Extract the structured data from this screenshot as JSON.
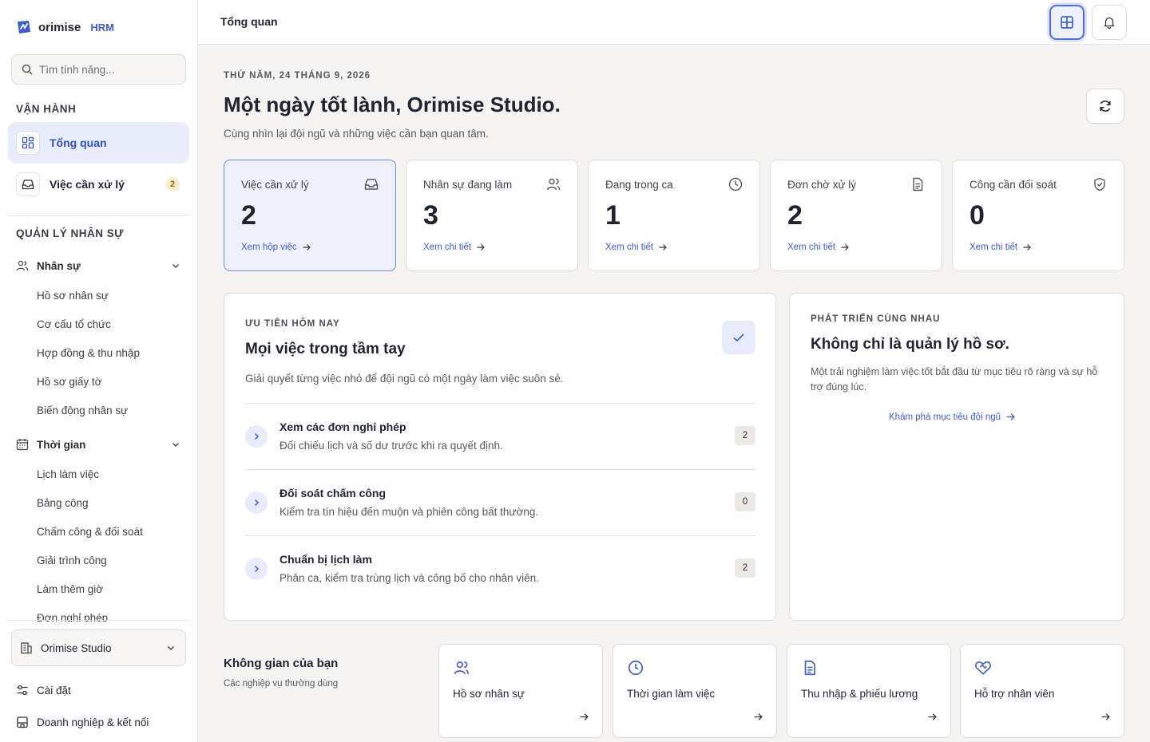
{
  "brand": {
    "name": "orimise",
    "suffix": "HRM",
    "accent": "#3b5bdb"
  },
  "search": {
    "placeholder": "Tìm tính năng..."
  },
  "sidebar": {
    "section_ops": "VẬN HÀNH",
    "nav": [
      {
        "label": "Tổng quan",
        "icon": "dashboard-icon",
        "active": true
      },
      {
        "label": "Việc cần xử lý",
        "icon": "inbox-icon",
        "badge": "2"
      }
    ],
    "section_hr": "QUẢN LÝ NHÂN SỰ",
    "groups": [
      {
        "label": "Nhân sự",
        "icon": "users-icon",
        "items": [
          "Hồ sơ nhân sự",
          "Cơ cấu tổ chức",
          "Hợp đồng & thu nhập",
          "Hồ sơ giấy tờ",
          "Biến động nhân sự"
        ]
      },
      {
        "label": "Thời gian",
        "icon": "calendar-icon",
        "items": [
          "Lịch làm việc",
          "Bảng công",
          "Chấm công & đối soát",
          "Giải trình công",
          "Làm thêm giờ",
          "Đơn nghỉ phép"
        ]
      }
    ],
    "org": "Orimise Studio",
    "footer": [
      {
        "label": "Cài đặt",
        "icon": "settings-icon"
      },
      {
        "label": "Doanh nghiệp & kết nối",
        "icon": "building-icon"
      }
    ]
  },
  "topbar": {
    "title": "Tổng quan"
  },
  "header": {
    "date": "THỨ NĂM, 24 THÁNG 9, 2026",
    "greeting": "Một ngày tốt lành, Orimise Studio.",
    "subtitle": "Cùng nhìn lại đội ngũ và những việc cần bạn quan tâm."
  },
  "stats": [
    {
      "label": "Việc cần xử lý",
      "value": "2",
      "link": "Xem hộp việc",
      "icon": "inbox-icon"
    },
    {
      "label": "Nhân sự đang làm",
      "value": "3",
      "link": "Xem chi tiết",
      "icon": "users-icon"
    },
    {
      "label": "Đang trong ca",
      "value": "1",
      "link": "Xem chi tiết",
      "icon": "clock-icon"
    },
    {
      "label": "Đơn chờ xử lý",
      "value": "2",
      "link": "Xem chi tiết",
      "icon": "document-icon"
    },
    {
      "label": "Công cần đối soát",
      "value": "0",
      "link": "Xem chi tiết",
      "icon": "shield-icon"
    }
  ],
  "priority": {
    "kicker": "ƯU TIÊN HÔM NAY",
    "title": "Mọi việc trong tầm tay",
    "desc": "Giải quyết từng việc nhỏ để đội ngũ có một ngày làm việc suôn sẻ.",
    "tasks": [
      {
        "title": "Xem các đơn nghỉ phép",
        "desc": "Đối chiếu lịch và số dư trước khi ra quyết định.",
        "count": "2"
      },
      {
        "title": "Đối soát chấm công",
        "desc": "Kiểm tra tín hiệu đến muộn và phiên công bất thường.",
        "count": "0"
      },
      {
        "title": "Chuẩn bị lịch làm",
        "desc": "Phân ca, kiểm tra trùng lịch và công bố cho nhân viên.",
        "count": "2"
      }
    ]
  },
  "growth": {
    "kicker": "PHÁT TRIỂN CÙNG NHAU",
    "title": "Không chỉ là quản lý hồ sơ.",
    "desc": "Một trải nghiệm làm việc tốt bắt đầu từ mục tiêu rõ ràng và sự hỗ trợ đúng lúc.",
    "link": "Khám phá mục tiêu đội ngũ"
  },
  "workspace": {
    "title": "Không gian của bạn",
    "subtitle": "Các nghiệp vụ thường dùng",
    "tiles": [
      {
        "label": "Hồ sơ nhân sự",
        "icon": "users-icon"
      },
      {
        "label": "Thời gian làm việc",
        "icon": "clock-icon"
      },
      {
        "label": "Thu nhập & phiếu lương",
        "icon": "document-icon"
      },
      {
        "label": "Hỗ trợ nhân viên",
        "icon": "heart-handshake-icon"
      }
    ]
  }
}
